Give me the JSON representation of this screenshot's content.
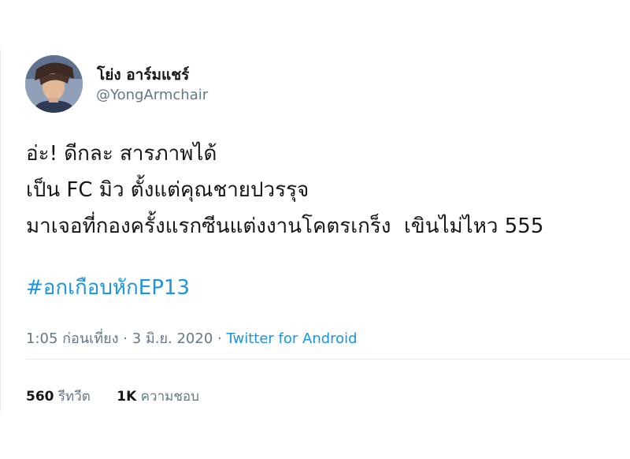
{
  "author": {
    "display_name": "โย่ง อาร์มแชร์",
    "handle": "@YongArmchair",
    "avatar_icon": "profile-photo"
  },
  "tweet": {
    "lines": [
      "อ่ะ! ดีกละ สารภาพได้",
      "เป็น FC มิว ตั้งแต่คุณชายปวรรุจ",
      "มาเจอที่กองครั้งแรกซีนแต่งงานโคตรเกร็ง  เขินไม่ไหว 555"
    ],
    "hashtag": "#อกเกือบหักEP13"
  },
  "meta": {
    "time": "1:05 ก่อนเที่ยง",
    "separator": "·",
    "date": "3 มิ.ย. 2020",
    "source": "Twitter for Android"
  },
  "stats": {
    "retweets_count": "560",
    "retweets_label": "รีทวีต",
    "likes_count": "1K",
    "likes_label": "ความชอบ"
  },
  "colors": {
    "link": "#1b95e0",
    "secondary_text": "#657786",
    "primary_text": "#14171a"
  }
}
